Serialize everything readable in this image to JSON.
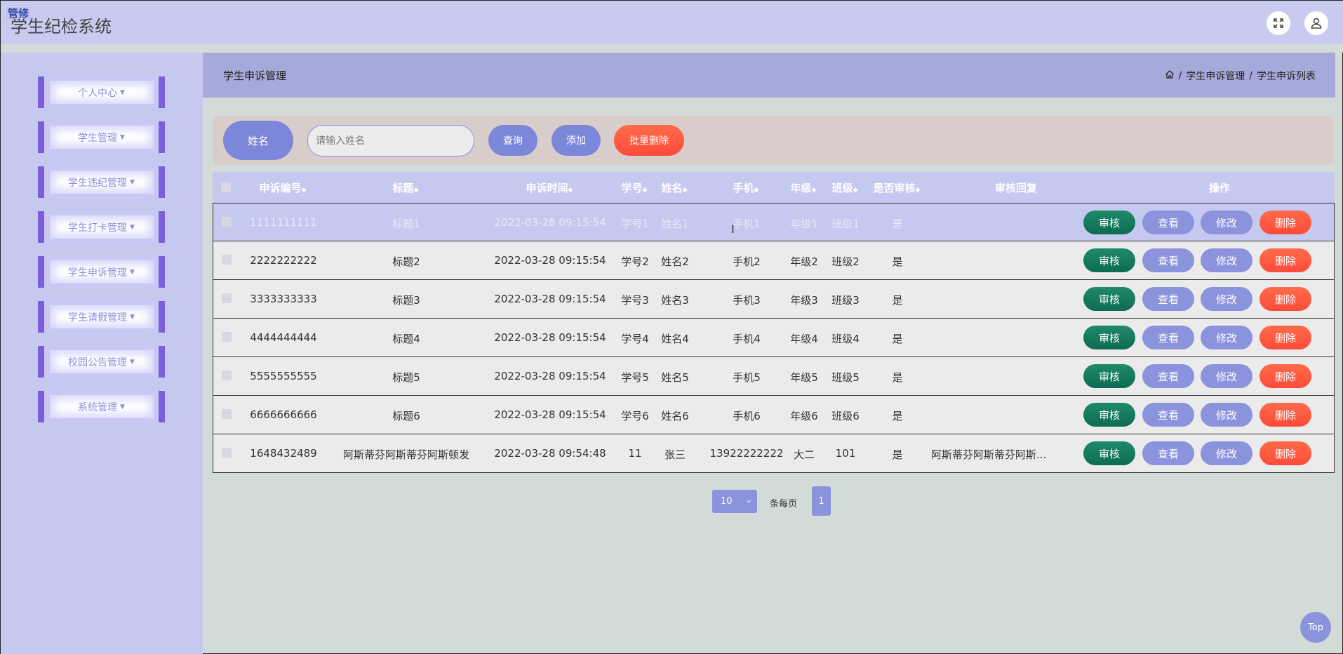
{
  "app": {
    "badge": "管修",
    "title": "学生纪检系统"
  },
  "top_icons": [
    "fullscreen-icon",
    "user-icon"
  ],
  "sidebar": {
    "items": [
      {
        "label": "个人中心"
      },
      {
        "label": "学生管理"
      },
      {
        "label": "学生违纪管理"
      },
      {
        "label": "学生打卡管理"
      },
      {
        "label": "学生申诉管理"
      },
      {
        "label": "学生请假管理"
      },
      {
        "label": "校园公告管理"
      },
      {
        "label": "系统管理"
      }
    ]
  },
  "header": {
    "title": "学生申诉管理",
    "breadcrumb": [
      "学生申诉管理",
      "学生申诉列表"
    ]
  },
  "search": {
    "label": "姓名",
    "placeholder": "请输入姓名",
    "query_button": "查询",
    "add_button": "添加",
    "batch_delete_button": "批量删除"
  },
  "table": {
    "headers": [
      "申诉编号",
      "标题",
      "申诉时间",
      "学号",
      "姓名",
      "手机",
      "年级",
      "班级",
      "是否审核",
      "审核回复",
      "操作"
    ],
    "actions": {
      "audit": "审核",
      "view": "查看",
      "edit": "修改",
      "delete": "删除"
    },
    "rows": [
      [
        "1111111111",
        "标题1",
        "2022-03-28 09:15:54",
        "学号1",
        "姓名1",
        "手机1",
        "年级1",
        "班级1",
        "是",
        ""
      ],
      [
        "2222222222",
        "标题2",
        "2022-03-28 09:15:54",
        "学号2",
        "姓名2",
        "手机2",
        "年级2",
        "班级2",
        "是",
        ""
      ],
      [
        "3333333333",
        "标题3",
        "2022-03-28 09:15:54",
        "学号3",
        "姓名3",
        "手机3",
        "年级3",
        "班级3",
        "是",
        ""
      ],
      [
        "4444444444",
        "标题4",
        "2022-03-28 09:15:54",
        "学号4",
        "姓名4",
        "手机4",
        "年级4",
        "班级4",
        "是",
        ""
      ],
      [
        "5555555555",
        "标题5",
        "2022-03-28 09:15:54",
        "学号5",
        "姓名5",
        "手机5",
        "年级5",
        "班级5",
        "是",
        ""
      ],
      [
        "6666666666",
        "标题6",
        "2022-03-28 09:15:54",
        "学号6",
        "姓名6",
        "手机6",
        "年级6",
        "班级6",
        "是",
        ""
      ],
      [
        "1648432489",
        "阿斯蒂芬阿斯蒂芬阿斯顿发",
        "2022-03-28 09:54:48",
        "11",
        "张三",
        "13922222222",
        "大二",
        "101",
        "是",
        "阿斯蒂芬阿斯蒂芬阿斯..."
      ]
    ]
  },
  "pagination": {
    "page_size": "10",
    "per_page_label": "条每页",
    "current_page": "1"
  },
  "back_to_top": "Top",
  "colors": {
    "accent": "#7d87d9",
    "header_bg": "#a5aadb",
    "sidebar_bg": "#c6c9ef",
    "audit_green": "#0d6b52",
    "danger_red": "#ff4b3a"
  }
}
